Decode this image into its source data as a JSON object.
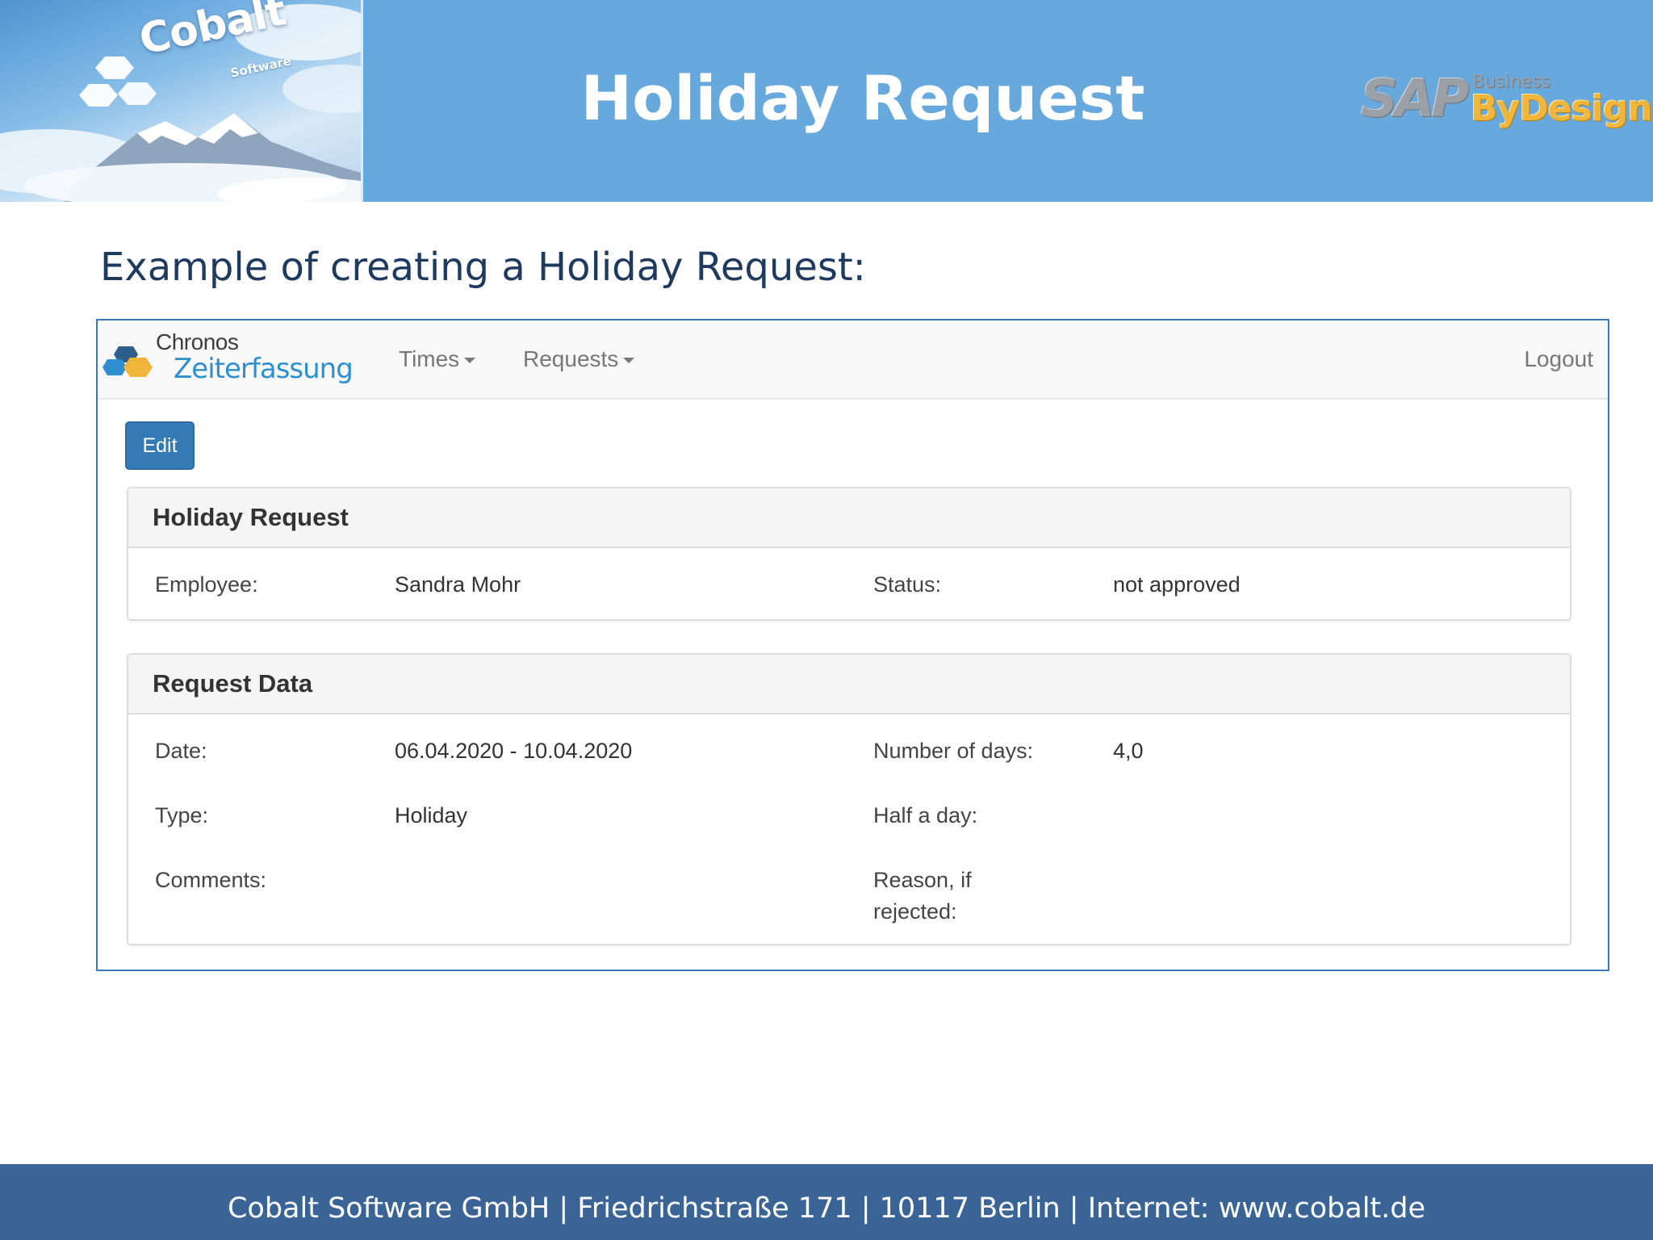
{
  "slide": {
    "brand_logo_text": "Cobalt",
    "brand_logo_subtext": "Software",
    "title": "Holiday Request",
    "partner_logo": {
      "main": "SAP",
      "line1": "Business",
      "line2": "ByDesign"
    },
    "subtitle": "Example of creating a Holiday Request:",
    "footer": "Cobalt Software GmbH | Friedrichstraße 171 | 10117 Berlin | Internet: www.cobalt.de"
  },
  "app": {
    "brand": {
      "line1": "Chronos",
      "line2": "Zeiterfassung"
    },
    "nav": {
      "times": "Times",
      "requests": "Requests",
      "logout": "Logout"
    },
    "edit_label": "Edit",
    "holiday_panel": {
      "title": "Holiday Request",
      "employee_label": "Employee:",
      "employee_value": "Sandra Mohr",
      "status_label": "Status:",
      "status_value": "not approved"
    },
    "request_panel": {
      "title": "Request Data",
      "date_label": "Date:",
      "date_value": "06.04.2020 - 10.04.2020",
      "days_label": "Number of days:",
      "days_value": "4,0",
      "type_label": "Type:",
      "type_value": "Holiday",
      "half_day_label": "Half a day:",
      "comments_label": "Comments:",
      "reason_label_line1": "Reason, if",
      "reason_label_line2": "rejected:"
    }
  },
  "colors": {
    "header_band": "#68a9dd",
    "footer_band": "#3a6496",
    "frame_border": "#3c79b8",
    "primary_button": "#337ab7",
    "brand_blue": "#2d8fcf",
    "logo_orange": "#f0b63c"
  }
}
